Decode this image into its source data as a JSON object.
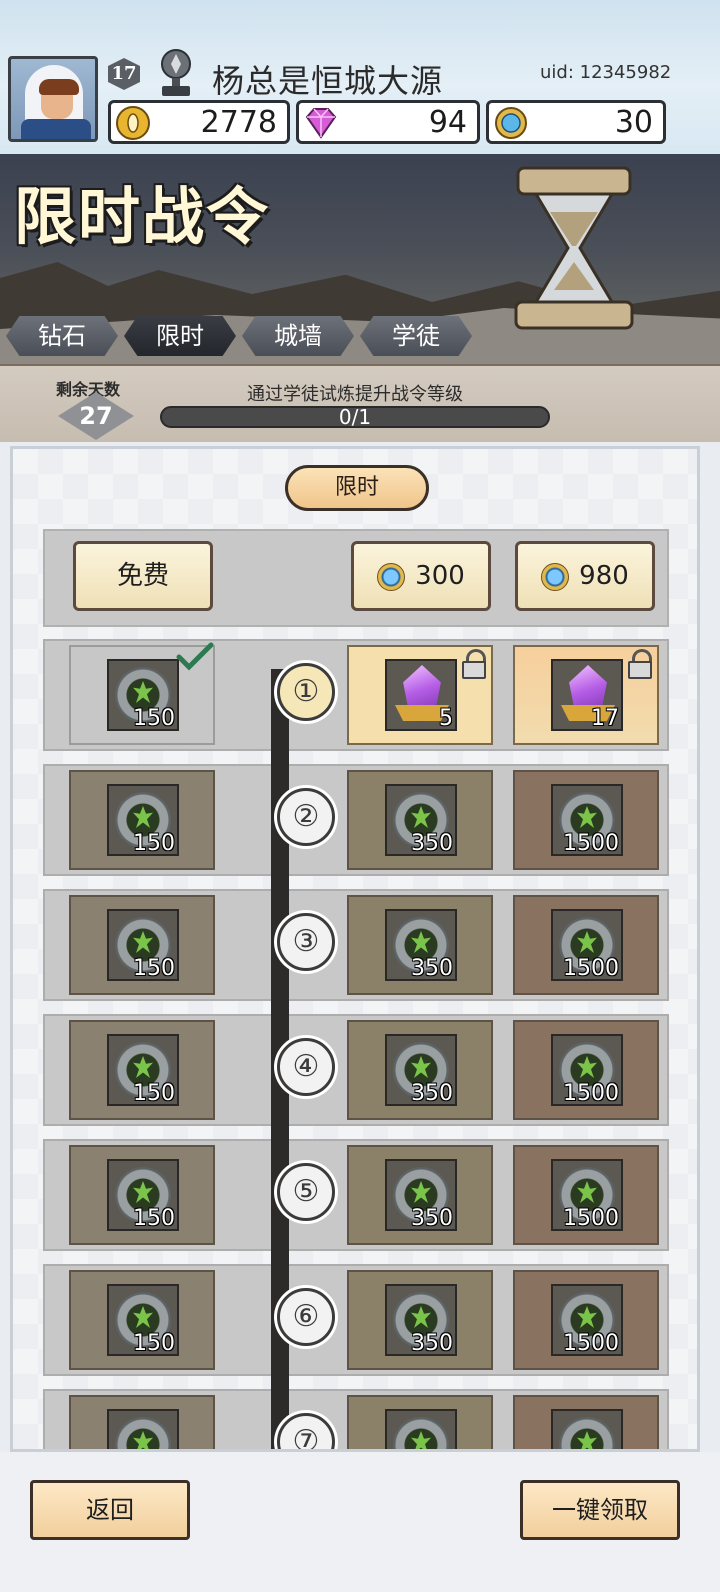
{
  "player": {
    "name": "杨总是恒城大源",
    "level": "17",
    "uid": "uid: 12345982"
  },
  "resources": {
    "gold": "2778",
    "gems": "94",
    "tokens": "30"
  },
  "banner": {
    "title": "限时战令"
  },
  "tabs": [
    "钻石",
    "限时",
    "城墙",
    "学徒"
  ],
  "active_tab": "限时",
  "status": {
    "days_label": "剩余天数",
    "days_value": "27",
    "task_text": "通过学徒试炼提升战令等级",
    "progress_text": "0/1",
    "progress_fraction": 0
  },
  "section": {
    "label": "限时"
  },
  "tiers": {
    "free_label": "免费",
    "pay1_price": "300",
    "pay2_price": "980"
  },
  "levels": [
    {
      "num": "①",
      "free": "150",
      "mid": "5",
      "high": "17"
    },
    {
      "num": "②",
      "free": "150",
      "mid": "350",
      "high": "1500"
    },
    {
      "num": "③",
      "free": "150",
      "mid": "350",
      "high": "1500"
    },
    {
      "num": "④",
      "free": "150",
      "mid": "350",
      "high": "1500"
    },
    {
      "num": "⑤",
      "free": "150",
      "mid": "350",
      "high": "1500"
    },
    {
      "num": "⑥",
      "free": "150",
      "mid": "350",
      "high": "1500"
    },
    {
      "num": "⑦",
      "free": "",
      "mid": "",
      "high": ""
    }
  ],
  "footer": {
    "back_label": "返回",
    "claim_label": "一键领取"
  },
  "icons": {
    "gold": "gold-coin-icon",
    "gem": "diamond-icon",
    "token": "blue-token-icon",
    "reward_leaf": "leaf-emblem-icon",
    "reward_crystal": "purple-crystal-icon",
    "claimed": "checkmark-icon",
    "locked": "lock-icon"
  }
}
